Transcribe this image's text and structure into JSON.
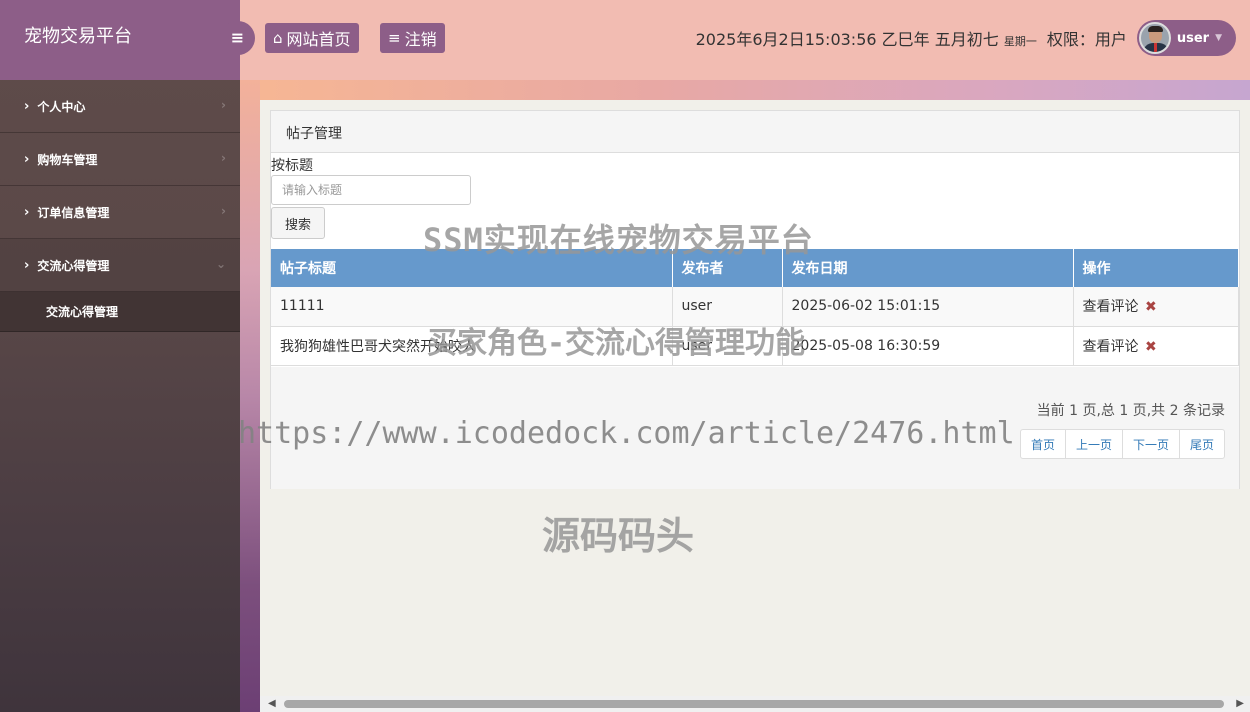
{
  "app": {
    "title": "宠物交易平台"
  },
  "sidebar": {
    "items": [
      {
        "label": "个人中心"
      },
      {
        "label": "购物车管理"
      },
      {
        "label": "订单信息管理"
      },
      {
        "label": "交流心得管理"
      }
    ],
    "submenu": {
      "label": "交流心得管理"
    }
  },
  "topbar": {
    "home_label": "网站首页",
    "logout_label": "注销",
    "datetime": "2025年6月2日15:03:56 乙巳年 五月初七",
    "weekday": "星期一",
    "role": "权限：用户",
    "username": "user"
  },
  "panel": {
    "title": "帖子管理",
    "search_label": "按标题",
    "search_placeholder": "请输入标题",
    "search_button": "搜索"
  },
  "table": {
    "headers": [
      "帖子标题",
      "发布者",
      "发布日期",
      "操作"
    ],
    "rows": [
      {
        "title": "11111",
        "author": "user",
        "date": "2025-06-02 15:01:15",
        "action": "查看评论"
      },
      {
        "title": "我狗狗雄性巴哥犬突然开始咬人",
        "author": "user",
        "date": "2025-05-08 16:30:59",
        "action": "查看评论"
      }
    ]
  },
  "pagination": {
    "info": "当前 1 页,总 1 页,共 2 条记录",
    "first": "首页",
    "prev": "上一页",
    "next": "下一页",
    "last": "尾页"
  },
  "watermarks": {
    "line1": "SSM实现在线宠物交易平台",
    "line2": "买家角色-交流心得管理功能",
    "line3": "https://www.icodedock.com/article/2476.html",
    "line4": "源码码头"
  },
  "colors": {
    "accent": "#8d5e88",
    "topbar": "#f2bcb2",
    "table_header": "#6699cc",
    "delete": "#a94442"
  }
}
